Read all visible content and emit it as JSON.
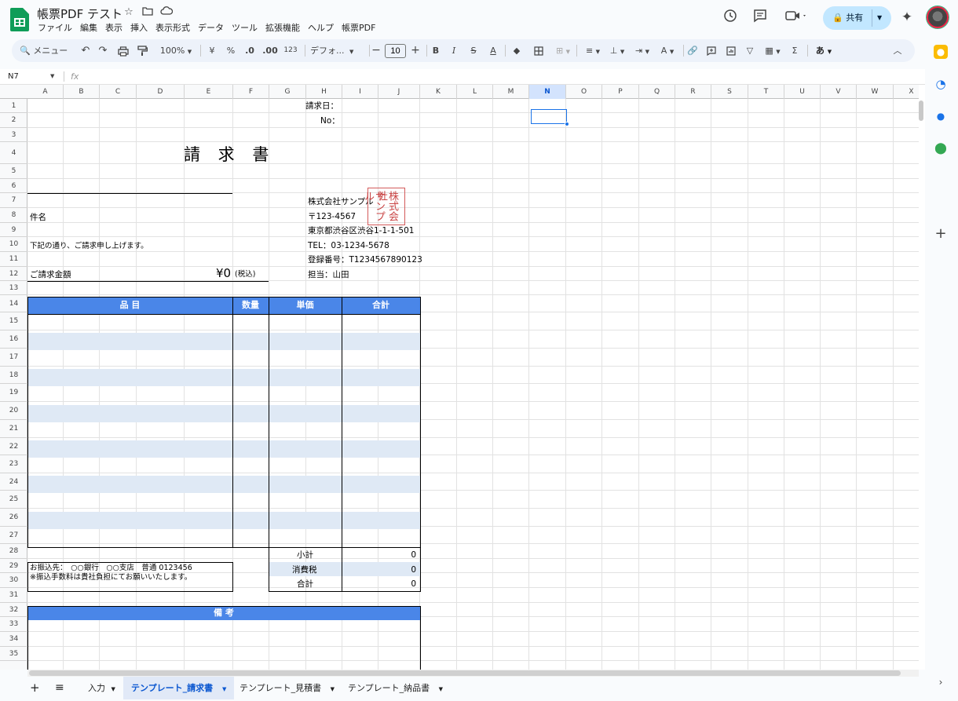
{
  "app": {
    "doc_title": "帳票PDF テスト",
    "menu": [
      "ファイル",
      "編集",
      "表示",
      "挿入",
      "表示形式",
      "データ",
      "ツール",
      "拡張機能",
      "ヘルプ",
      "帳票PDF"
    ],
    "share_label": "共有"
  },
  "toolbar": {
    "menu_search": "メニュー",
    "zoom": "100%",
    "currency": "¥",
    "percent": "%",
    "dec_less": ".0",
    "dec_more": ".00",
    "format_123": "123",
    "font": "デフォ...",
    "font_size": "10",
    "input_mode": "あ"
  },
  "formula_bar": {
    "name_box": "N7",
    "fx": "fx"
  },
  "columns": [
    "A",
    "B",
    "C",
    "D",
    "E",
    "F",
    "G",
    "H",
    "I",
    "J",
    "K",
    "L",
    "M",
    "N",
    "O",
    "P",
    "Q",
    "R",
    "S",
    "T",
    "U",
    "V",
    "W",
    "X"
  ],
  "selected_column": "N",
  "rows": [
    "1",
    "2",
    "3",
    "4",
    "5",
    "6",
    "7",
    "8",
    "9",
    "10",
    "11",
    "12",
    "13",
    "14",
    "15",
    "16",
    "17",
    "18",
    "19",
    "20",
    "21",
    "22",
    "23",
    "24",
    "25",
    "26",
    "27",
    "28",
    "29",
    "30",
    "31",
    "32",
    "33",
    "34",
    "35"
  ],
  "invoice": {
    "date_label": "請求日：",
    "no_label": "No：",
    "title": "請 求 書",
    "subject_label": "件名",
    "intro": "下記の通り、ご請求申し上げます。",
    "amount_label": "ご請求金額",
    "amount_value": "¥0",
    "amount_tax_note": "(税込)",
    "company": {
      "name": "株式会社サンプル",
      "postal": "〒123-4567",
      "address": "東京都渋谷区渋谷1-1-1-501",
      "tel": "TEL：03-1234-5678",
      "reg_no": "登録番号：T1234567890123",
      "contact": "担当：山田"
    },
    "stamp_text": [
      "株式会社",
      "サンプル"
    ],
    "table_headers": {
      "item": "品 目",
      "qty": "数量",
      "unit_price": "単価",
      "total": "合計"
    },
    "subtotal_label": "小計",
    "subtotal_value": "0",
    "tax_label": "消費税",
    "tax_value": "0",
    "total_label": "合計",
    "total_value": "0",
    "bank_line1": "お振込先：　○○銀行　○○支店　普通 0123456",
    "bank_line2": "※振込手数料は貴社負担にてお願いいたします。",
    "remarks_header": "備 考"
  },
  "sheet_tabs": [
    {
      "label": "入力",
      "active": false
    },
    {
      "label": "テンプレート_請求書",
      "active": true
    },
    {
      "label": "テンプレート_見積書",
      "active": false
    },
    {
      "label": "テンプレート_納品書",
      "active": false
    }
  ],
  "colors": {
    "accent": "#4a86e8",
    "band": "#dfe9f5",
    "selection": "#1a73e8",
    "stamp": "#c94444"
  }
}
